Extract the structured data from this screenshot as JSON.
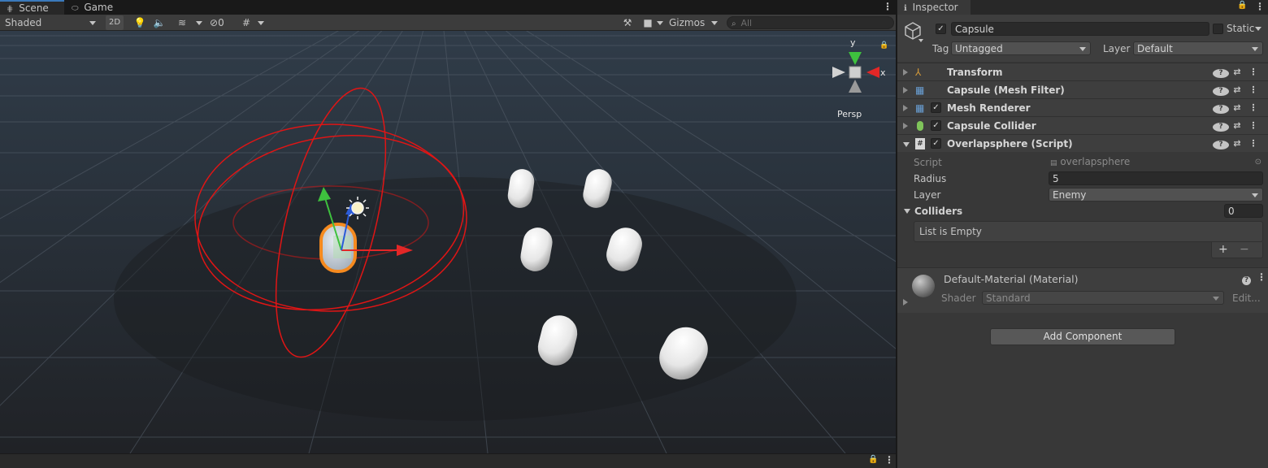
{
  "scene": {
    "tabs": [
      {
        "label": "Scene",
        "active": true,
        "icon": "grid-icon"
      },
      {
        "label": "Game",
        "active": false,
        "icon": "gamepad-icon"
      }
    ],
    "toolbar": {
      "shading_mode": "Shaded",
      "mode_2d": "2D",
      "hidden_count": "0",
      "gizmos_label": "Gizmos",
      "search_placeholder": "All"
    },
    "gizmo": {
      "axis_y": "y",
      "axis_x": "x",
      "projection": "Persp"
    }
  },
  "inspector": {
    "tab_label": "Inspector",
    "object": {
      "name": "Capsule",
      "active": true,
      "static_label": "Static",
      "tag_label": "Tag",
      "tag_value": "Untagged",
      "layer_label": "Layer",
      "layer_value": "Default"
    },
    "components": [
      {
        "name": "Transform",
        "has_checkbox": false,
        "icon": "transform-icon",
        "expanded": false
      },
      {
        "name": "Capsule (Mesh Filter)",
        "has_checkbox": false,
        "icon": "mesh-filter-icon",
        "expanded": false
      },
      {
        "name": "Mesh Renderer",
        "has_checkbox": true,
        "icon": "mesh-renderer-icon",
        "expanded": false
      },
      {
        "name": "Capsule Collider",
        "has_checkbox": true,
        "icon": "capsule-collider-icon",
        "expanded": false
      },
      {
        "name": "Overlapsphere (Script)",
        "has_checkbox": true,
        "icon": "script-icon",
        "expanded": true
      }
    ],
    "script_fields": {
      "script_label": "Script",
      "script_value": "overlapsphere",
      "radius_label": "Radius",
      "radius_value": "5",
      "layer_label": "Layer",
      "layer_value": "Enemy",
      "colliders_label": "Colliders",
      "colliders_count": "0",
      "list_empty_text": "List is Empty",
      "add_symbol": "+",
      "remove_symbol": "−"
    },
    "material": {
      "name": "Default-Material (Material)",
      "shader_label": "Shader",
      "shader_value": "Standard",
      "edit_label": "Edit..."
    },
    "add_component_label": "Add Component"
  },
  "colors": {
    "selection_outline": "#f58a1f",
    "collider_gizmo": "#e01515",
    "axis_x": "#e32727",
    "axis_y": "#3ec13e",
    "axis_z": "#2b5bd8",
    "tab_accent": "#3a79bb"
  }
}
